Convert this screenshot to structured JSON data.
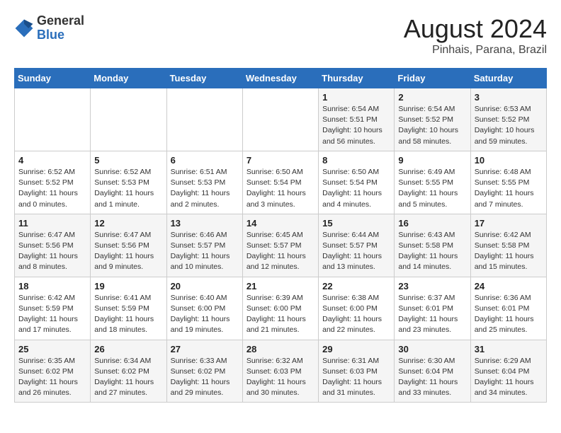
{
  "header": {
    "logo_line1": "General",
    "logo_line2": "Blue",
    "month_year": "August 2024",
    "location": "Pinhais, Parana, Brazil"
  },
  "weekdays": [
    "Sunday",
    "Monday",
    "Tuesday",
    "Wednesday",
    "Thursday",
    "Friday",
    "Saturday"
  ],
  "weeks": [
    [
      {
        "day": "",
        "info": ""
      },
      {
        "day": "",
        "info": ""
      },
      {
        "day": "",
        "info": ""
      },
      {
        "day": "",
        "info": ""
      },
      {
        "day": "1",
        "info": "Sunrise: 6:54 AM\nSunset: 5:51 PM\nDaylight: 10 hours\nand 56 minutes."
      },
      {
        "day": "2",
        "info": "Sunrise: 6:54 AM\nSunset: 5:52 PM\nDaylight: 10 hours\nand 58 minutes."
      },
      {
        "day": "3",
        "info": "Sunrise: 6:53 AM\nSunset: 5:52 PM\nDaylight: 10 hours\nand 59 minutes."
      }
    ],
    [
      {
        "day": "4",
        "info": "Sunrise: 6:52 AM\nSunset: 5:52 PM\nDaylight: 11 hours\nand 0 minutes."
      },
      {
        "day": "5",
        "info": "Sunrise: 6:52 AM\nSunset: 5:53 PM\nDaylight: 11 hours\nand 1 minute."
      },
      {
        "day": "6",
        "info": "Sunrise: 6:51 AM\nSunset: 5:53 PM\nDaylight: 11 hours\nand 2 minutes."
      },
      {
        "day": "7",
        "info": "Sunrise: 6:50 AM\nSunset: 5:54 PM\nDaylight: 11 hours\nand 3 minutes."
      },
      {
        "day": "8",
        "info": "Sunrise: 6:50 AM\nSunset: 5:54 PM\nDaylight: 11 hours\nand 4 minutes."
      },
      {
        "day": "9",
        "info": "Sunrise: 6:49 AM\nSunset: 5:55 PM\nDaylight: 11 hours\nand 5 minutes."
      },
      {
        "day": "10",
        "info": "Sunrise: 6:48 AM\nSunset: 5:55 PM\nDaylight: 11 hours\nand 7 minutes."
      }
    ],
    [
      {
        "day": "11",
        "info": "Sunrise: 6:47 AM\nSunset: 5:56 PM\nDaylight: 11 hours\nand 8 minutes."
      },
      {
        "day": "12",
        "info": "Sunrise: 6:47 AM\nSunset: 5:56 PM\nDaylight: 11 hours\nand 9 minutes."
      },
      {
        "day": "13",
        "info": "Sunrise: 6:46 AM\nSunset: 5:57 PM\nDaylight: 11 hours\nand 10 minutes."
      },
      {
        "day": "14",
        "info": "Sunrise: 6:45 AM\nSunset: 5:57 PM\nDaylight: 11 hours\nand 12 minutes."
      },
      {
        "day": "15",
        "info": "Sunrise: 6:44 AM\nSunset: 5:57 PM\nDaylight: 11 hours\nand 13 minutes."
      },
      {
        "day": "16",
        "info": "Sunrise: 6:43 AM\nSunset: 5:58 PM\nDaylight: 11 hours\nand 14 minutes."
      },
      {
        "day": "17",
        "info": "Sunrise: 6:42 AM\nSunset: 5:58 PM\nDaylight: 11 hours\nand 15 minutes."
      }
    ],
    [
      {
        "day": "18",
        "info": "Sunrise: 6:42 AM\nSunset: 5:59 PM\nDaylight: 11 hours\nand 17 minutes."
      },
      {
        "day": "19",
        "info": "Sunrise: 6:41 AM\nSunset: 5:59 PM\nDaylight: 11 hours\nand 18 minutes."
      },
      {
        "day": "20",
        "info": "Sunrise: 6:40 AM\nSunset: 6:00 PM\nDaylight: 11 hours\nand 19 minutes."
      },
      {
        "day": "21",
        "info": "Sunrise: 6:39 AM\nSunset: 6:00 PM\nDaylight: 11 hours\nand 21 minutes."
      },
      {
        "day": "22",
        "info": "Sunrise: 6:38 AM\nSunset: 6:00 PM\nDaylight: 11 hours\nand 22 minutes."
      },
      {
        "day": "23",
        "info": "Sunrise: 6:37 AM\nSunset: 6:01 PM\nDaylight: 11 hours\nand 23 minutes."
      },
      {
        "day": "24",
        "info": "Sunrise: 6:36 AM\nSunset: 6:01 PM\nDaylight: 11 hours\nand 25 minutes."
      }
    ],
    [
      {
        "day": "25",
        "info": "Sunrise: 6:35 AM\nSunset: 6:02 PM\nDaylight: 11 hours\nand 26 minutes."
      },
      {
        "day": "26",
        "info": "Sunrise: 6:34 AM\nSunset: 6:02 PM\nDaylight: 11 hours\nand 27 minutes."
      },
      {
        "day": "27",
        "info": "Sunrise: 6:33 AM\nSunset: 6:02 PM\nDaylight: 11 hours\nand 29 minutes."
      },
      {
        "day": "28",
        "info": "Sunrise: 6:32 AM\nSunset: 6:03 PM\nDaylight: 11 hours\nand 30 minutes."
      },
      {
        "day": "29",
        "info": "Sunrise: 6:31 AM\nSunset: 6:03 PM\nDaylight: 11 hours\nand 31 minutes."
      },
      {
        "day": "30",
        "info": "Sunrise: 6:30 AM\nSunset: 6:04 PM\nDaylight: 11 hours\nand 33 minutes."
      },
      {
        "day": "31",
        "info": "Sunrise: 6:29 AM\nSunset: 6:04 PM\nDaylight: 11 hours\nand 34 minutes."
      }
    ]
  ]
}
